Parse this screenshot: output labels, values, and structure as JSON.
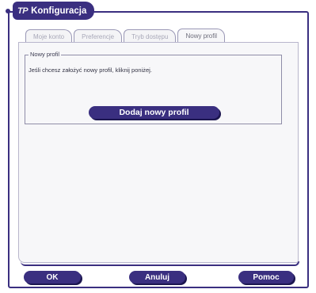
{
  "window": {
    "logo": "TP",
    "title": "Konfiguracja"
  },
  "tabs": [
    {
      "label": "Moje konto",
      "active": false
    },
    {
      "label": "Preferencje",
      "active": false
    },
    {
      "label": "Tryb dostępu",
      "active": false
    },
    {
      "label": "Nowy profil",
      "active": true
    }
  ],
  "group": {
    "title": "Nowy profil",
    "text": "Jeśli chcesz założyć nowy profil, kliknij poniżej.",
    "add_button": "Dodaj nowy profil"
  },
  "footer": {
    "ok": "OK",
    "cancel": "Anuluj",
    "help": "Pomoc"
  },
  "colors": {
    "accent": "#3a2f80",
    "panel": "#f7f7f9"
  }
}
